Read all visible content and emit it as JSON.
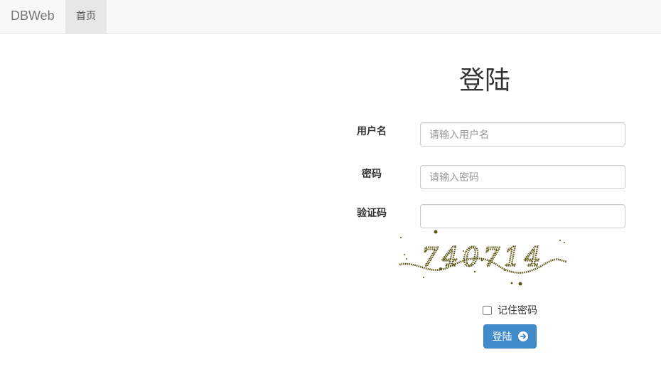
{
  "navbar": {
    "brand": "DBWeb",
    "home": "首页"
  },
  "login": {
    "title": "登陆",
    "username_label": "用户名",
    "username_placeholder": "请输入用户名",
    "password_label": "密码",
    "password_placeholder": "请输入密码",
    "captcha_label": "验证码",
    "captcha_value": "",
    "captcha_text": "740714",
    "remember_label": "记住密码",
    "remember_checked": false,
    "submit_label": "登陆",
    "submit_icon": "circle-arrow-right-icon"
  },
  "colors": {
    "primary": "#428bca",
    "navbar_bg": "#f8f8f8",
    "captcha_ink": "#5a5410"
  }
}
